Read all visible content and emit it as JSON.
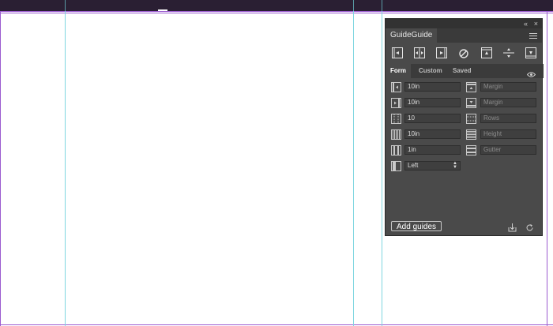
{
  "colors": {
    "canvas_bg": "#ffffff",
    "topbar_bg": "#2a1f33",
    "guide": "#7fd6e0",
    "page_border": "#9b5bd0",
    "panel_bg": "#4a4a4a",
    "panel_text": "#e6e6e6"
  },
  "panel": {
    "title": "GuideGuide",
    "collapse_icon": "«",
    "close_icon": "×",
    "menu_icon": "hamburger-menu-icon",
    "tools": [
      {
        "name": "left-edge-tool-icon"
      },
      {
        "name": "vertical-midpoint-tool-icon"
      },
      {
        "name": "right-edge-tool-icon"
      },
      {
        "name": "clear-guides-icon"
      },
      {
        "name": "top-edge-tool-icon"
      },
      {
        "name": "horizontal-midpoint-tool-icon"
      },
      {
        "name": "bottom-edge-tool-icon"
      }
    ],
    "tabs": [
      "Form",
      "Custom",
      "Saved"
    ],
    "active_tab": "Form",
    "left_fields": [
      {
        "icon": "column-margin-icon",
        "value": "10in"
      },
      {
        "icon": "column-margin-right-icon",
        "value": "10in"
      },
      {
        "icon": "columns-icon",
        "value": "10"
      },
      {
        "icon": "column-width-icon",
        "value": "10in"
      },
      {
        "icon": "column-gutter-icon",
        "value": "1in"
      }
    ],
    "right_fields": [
      {
        "icon": "row-margin-top-icon",
        "placeholder": "Margin"
      },
      {
        "icon": "row-margin-bottom-icon",
        "placeholder": "Margin"
      },
      {
        "icon": "rows-icon",
        "placeholder": "Rows"
      },
      {
        "icon": "row-height-icon",
        "placeholder": "Height"
      },
      {
        "icon": "row-gutter-icon",
        "placeholder": "Gutter"
      }
    ],
    "position_select": {
      "icon": "column-position-icon",
      "value": "Left"
    },
    "add_button_label": "Add guides",
    "footer_icons": [
      "import-icon",
      "refresh-icon"
    ]
  }
}
